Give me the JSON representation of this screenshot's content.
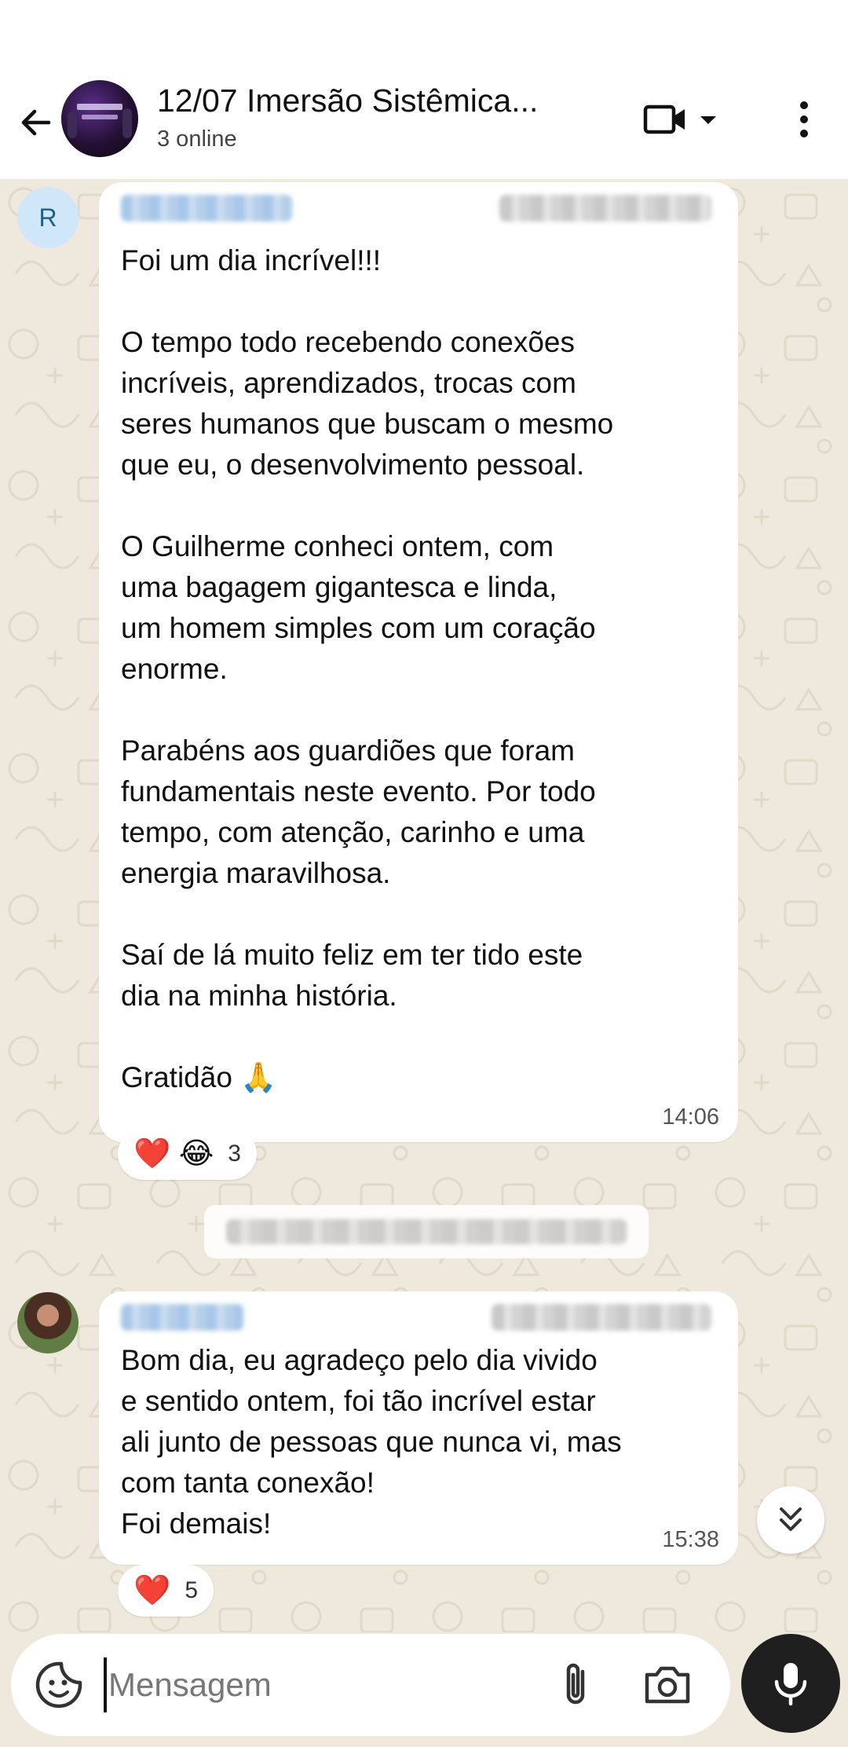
{
  "header": {
    "title": "12/07 Imersão Sistêmica...",
    "subtitle": "3 online",
    "group_avatar_icon": "group-avatar-image",
    "back_icon": "arrow-left-icon",
    "video_icon": "video-camera-icon",
    "menu_icon": "more-vert-icon"
  },
  "messages": [
    {
      "avatar_letter": "R",
      "lines": [
        "Foi um dia incrível!!!",
        "",
        "O tempo todo recebendo conexões",
        "incríveis, aprendizados, trocas com",
        "seres humanos que buscam o mesmo",
        "que eu, o desenvolvimento pessoal.",
        "",
        "O Guilherme conheci ontem, com",
        "uma bagagem gigantesca e linda,",
        "um homem simples com um coração",
        "enorme.",
        "",
        "Parabéns aos guardiões que foram",
        "fundamentais neste evento. Por todo",
        "tempo, com atenção, carinho e uma",
        "energia maravilhosa.",
        "",
        "Saí de lá muito feliz em ter tido este",
        "dia na minha história.",
        "",
        "Gratidão 🙏"
      ],
      "time": "14:06",
      "reactions": {
        "emojis": "❤️ 😂",
        "count": "3"
      }
    },
    {
      "lines": [
        "Bom dia, eu agradeço pelo dia vivido",
        "e sentido ontem, foi tão incrível estar",
        "ali junto de pessoas que nunca vi, mas",
        "com tanta conexão!",
        "Foi demais!"
      ],
      "time": "15:38",
      "reactions": {
        "emojis": "❤️",
        "count": "5"
      }
    }
  ],
  "composer": {
    "placeholder": "Mensagem",
    "value": ""
  },
  "colors": {
    "wallpaper": "#efe8dc",
    "bubble": "#ffffff",
    "header": "#ffffff",
    "mic_button": "#1f1f1f"
  }
}
